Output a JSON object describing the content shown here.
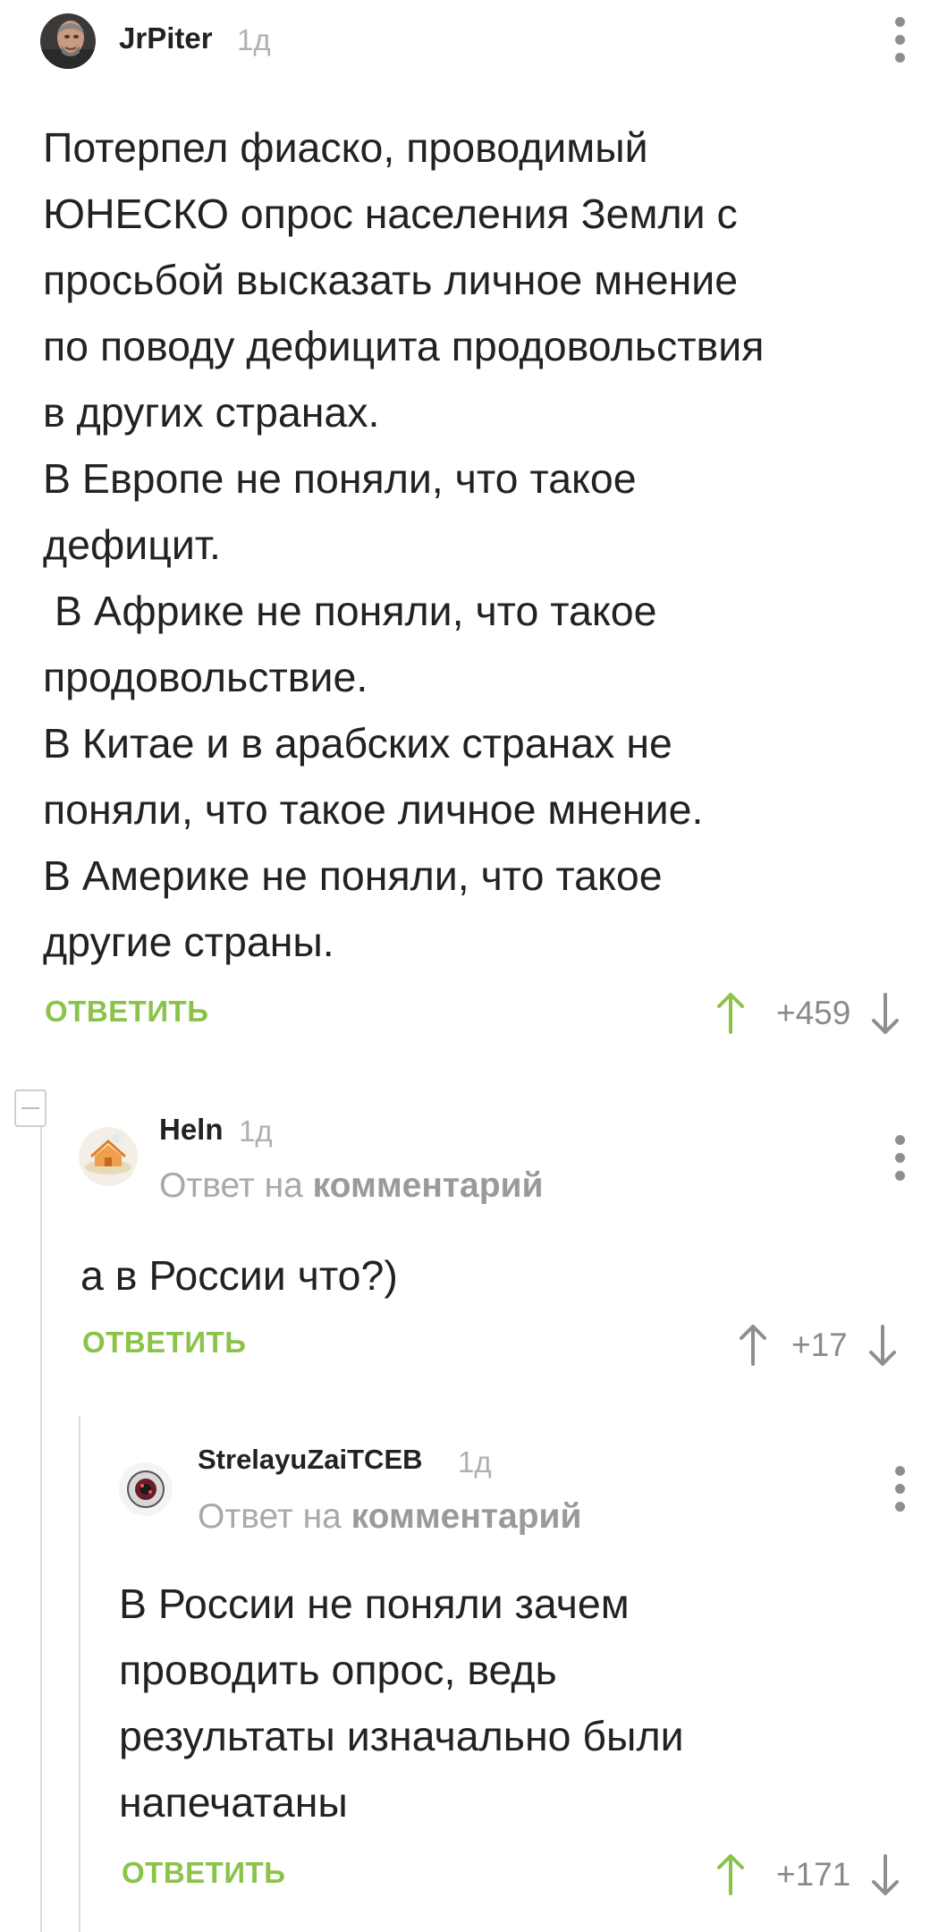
{
  "comments": [
    {
      "username": "JrPiter",
      "time": "1д",
      "body": "Потерпел фиаско, проводимый\nЮНЕСКО опрос населения Земли с\nпросьбой высказать личное мнение\nпо поводу дефицита продовольствия\nв других странах.\nВ Европе не поняли, что такое\nдефицит.\n В Африке не поняли, что такое\nпродовольствие.\nВ Китае и в арабских странах не\nпоняли, что такое личное мнение.\nВ Америке не поняли, что такое\nдругие страны.",
      "reply_label": "ОТВЕТИТЬ",
      "score": "+459"
    },
    {
      "username": "Heln",
      "time": "1д",
      "reply_prefix": "Ответ на",
      "reply_link": "комментарий",
      "body": "а в России что?)",
      "reply_label": "ОТВЕТИТЬ",
      "score": "+17"
    },
    {
      "username": "StrelayuZaiTCEB",
      "time": "1д",
      "reply_prefix": "Ответ на",
      "reply_link": "комментарий",
      "body": "В России не поняли зачем\nпроводить опрос, ведь\nрезультаты изначально были\nнапечатаны",
      "reply_label": "ОТВЕТИТЬ",
      "score": "+171"
    }
  ],
  "icons": {
    "upvote": "arrow-up-icon",
    "downvote": "arrow-down-icon",
    "more": "more-vertical-icon",
    "collapse": "minus-square-icon"
  },
  "colors": {
    "accent_green": "#8bc34a",
    "text": "#222222",
    "muted": "#a9a9a9",
    "thread_line": "#dcdcdc"
  }
}
